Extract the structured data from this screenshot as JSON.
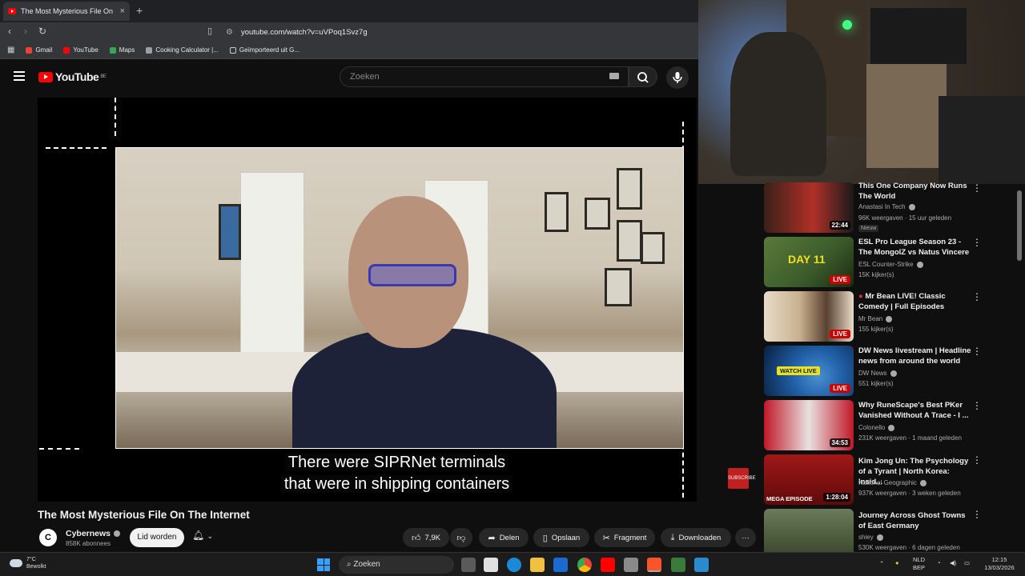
{
  "browser": {
    "tab_title": "The Most Mysterious File On",
    "tab_close": "×",
    "new_tab": "+",
    "url": "youtube.com/watch?v=uVPoq1Svz7g",
    "bookmarks": [
      {
        "label": "Gmail",
        "color": "#ea4335"
      },
      {
        "label": "YouTube",
        "color": "#ff0000"
      },
      {
        "label": "Maps",
        "color": "#34a853"
      },
      {
        "label": "Cooking Calculator |...",
        "color": "#9aa0a6"
      },
      {
        "label": "Geïmporteerd uit G...",
        "color": "#9aa0a6"
      }
    ]
  },
  "header": {
    "logo": "YouTube",
    "region": "BE",
    "search_placeholder": "Zoeken"
  },
  "player": {
    "subtitle_line1": "There were SIPRNet terminals",
    "subtitle_line2": "that were in shipping containers",
    "watermark": "SUBSCRIBE"
  },
  "video": {
    "title": "The Most Mysterious File On The Internet",
    "channel": "Cybernews",
    "channel_initial": "C",
    "subscribers": "858K abonnees",
    "join_label": "Lid worden",
    "likes": "7,9K",
    "share_label": "Delen",
    "save_label": "Opslaan",
    "clip_label": "Fragment",
    "download_label": "Downloaden",
    "more_label": "···"
  },
  "recommendations": [
    {
      "title": "This One Company Now Runs The World",
      "channel": "Anastasi In Tech",
      "meta": "96K weergaven · 15 uur geleden",
      "badge": "Nieuw",
      "duration": "22:44",
      "live": "",
      "thumb_color": "#b03028"
    },
    {
      "title": "ESL Pro League Season 23 - The MongolZ vs Natus Vincere",
      "channel": "ESL Counter-Strike",
      "meta": "15K kijker(s)",
      "badge": "",
      "duration": "",
      "live": "LIVE",
      "thumb_color": "#3a5a2a"
    },
    {
      "title": "Mr Bean LIVE! Classic Comedy | Full Episodes",
      "channel": "Mr Bean",
      "meta": "155 kijker(s)",
      "badge": "",
      "duration": "",
      "live": "LIVE",
      "thumb_color": "#d8c8b0"
    },
    {
      "title": "DW News livestream | Headline news from around the world",
      "channel": "DW News",
      "meta": "551 kijker(s)",
      "badge": "",
      "duration": "",
      "live": "LIVE",
      "thumb_color": "#2060a8"
    },
    {
      "title": "Why RuneScape's Best PKer Vanished Without A Trace - I ...",
      "channel": "Colonello",
      "meta": "231K weergaven · 1 maand geleden",
      "badge": "",
      "duration": "34:53",
      "live": "",
      "thumb_color": "#c01828"
    },
    {
      "title": "Kim Jong Un: The Psychology of a Tyrant | North Korea: Insid...",
      "channel": "National Geographic",
      "meta": "937K weergaven · 3 weken geleden",
      "badge": "",
      "duration": "1:28:04",
      "live": "",
      "thumb_color": "#7a1010"
    },
    {
      "title": "Journey Across Ghost Towns of East Germany",
      "channel": "shiey",
      "meta": "530K weergaven · 6 dagen geleden",
      "badge": "",
      "duration": "",
      "live": "",
      "thumb_color": "#4a5a3a"
    }
  ],
  "rec_overlays": {
    "dw_watch_live": "WATCH LIVE",
    "mega_episode": "MEGA EPISODE",
    "esl_day": "DAY 11"
  },
  "taskbar": {
    "temp": "7°C",
    "weather": "Bewolkt",
    "search": "Zoeken",
    "lang1": "NLD",
    "lang2": "BEP",
    "time": "12:15",
    "date": "13/03/2026"
  }
}
